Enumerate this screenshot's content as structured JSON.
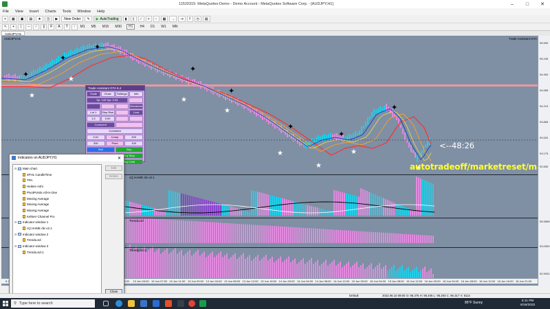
{
  "window": {
    "title": "11520315: MetaQuotes-Demo - Demo Account - MetaQuotes Software Corp. - [AUDJPY,H1]"
  },
  "menu": [
    "File",
    "View",
    "Insert",
    "Charts",
    "Tools",
    "Window",
    "Help"
  ],
  "toolbar": {
    "new_order": "New Order",
    "autotrading": "AutoTrading",
    "timeframes": [
      "M1",
      "M5",
      "M15",
      "M30",
      "H1",
      "H4",
      "D1",
      "W1",
      "MN"
    ]
  },
  "chart": {
    "tab": "AUDJPY,H1",
    "symbol_label": "AUDJPY,H1",
    "ea_label": "Trade Assistant GTA",
    "countdown": "<--48:26",
    "watermark": "autotradeoff/marketreset/manat",
    "price_ticks": [
      "95.590",
      "95.245",
      "94.900",
      "94.555",
      "94.210",
      "93.865",
      "93.520",
      "93.175",
      "92.830"
    ],
    "pane_scales": [
      "95.9898",
      "93.0000",
      "92.9931"
    ],
    "time_ticks": [
      "8 Jun 2022",
      "9 Jun 02:00",
      "9 Jun 06:00",
      "9 Jun 10:00",
      "9 Jun 14:00",
      "9 Jun 18:00",
      "9 Jun 22:00",
      "10 Jun 03:00",
      "10 Jun 07:00",
      "10 Jun 11:00",
      "13 Jun 00:00",
      "13 Jun 04:00",
      "13 Jun 08:00",
      "13 Jun 12:00",
      "13 Jun 16:00",
      "14 Jun 00:00",
      "14 Jun 04:00",
      "14 Jun 08:00",
      "14 Jun 12:00",
      "15 Jun 00:00",
      "15 Jun 04:00",
      "15 Jun 08:00",
      "15 Jun 12:00",
      "16 Jun 00:00",
      "16 Jun 04:00",
      "16 Jun 08:00",
      "16 Jun 12:00",
      "16 Jun 16:00",
      "16 Jun 21:00"
    ],
    "sub_pane_labels": [
      "cQ HAME div v2.1",
      "TrendLord",
      "TrendLord-1"
    ]
  },
  "trade_panel": {
    "title": "Trade Assistant GTA 9.4",
    "tabs": [
      "Trade",
      "Close",
      "Settings",
      "Info"
    ],
    "sp_row": "Sp: 126  Spr: 0.06",
    "rows": [
      [
        "",
        "",
        "",
        "Breakeven"
      ],
      [
        "Lot 1",
        "Stop Risk",
        "",
        "Loss"
      ],
      [
        "1.0",
        "0.00",
        "",
        ""
      ]
    ],
    "comment_label": "Comment",
    "comment_field": "Comment",
    "lot_row": [
      "0.01",
      "Comp",
      "200"
    ],
    "sl_row": [
      "300",
      "Price",
      "100"
    ],
    "buy_sell": [
      "Sell",
      "Buy"
    ],
    "stop_row": [
      "Sell Stop",
      "Buy Stop"
    ],
    "limit_row": [
      "Sell Limit",
      "Buy Limit"
    ]
  },
  "indicators_dialog": {
    "title": "Indicators on AUDJPY,H1",
    "tree": [
      {
        "label": "Main chart",
        "level": 0,
        "kind": "window"
      },
      {
        "label": "4PHL CandleTime",
        "level": 1,
        "kind": "indicator"
      },
      {
        "label": "TPA",
        "level": 1,
        "kind": "indicator"
      },
      {
        "label": "Heiken Ashi",
        "level": 1,
        "kind": "indicator"
      },
      {
        "label": "PivotPoints.All-In-One",
        "level": 1,
        "kind": "indicator"
      },
      {
        "label": "Moving Average",
        "level": 1,
        "kind": "indicator"
      },
      {
        "label": "Moving Average",
        "level": 1,
        "kind": "indicator"
      },
      {
        "label": "Moving Average",
        "level": 1,
        "kind": "indicator"
      },
      {
        "label": "Keltner Channel Pro",
        "level": 1,
        "kind": "indicator"
      },
      {
        "label": "Indicator window 1",
        "level": 0,
        "kind": "window"
      },
      {
        "label": "cQ HAME div v2.1",
        "level": 1,
        "kind": "indicator"
      },
      {
        "label": "Indicator window 2",
        "level": 0,
        "kind": "window"
      },
      {
        "label": "TrendLord",
        "level": 1,
        "kind": "indicator"
      },
      {
        "label": "Indicator window 3",
        "level": 0,
        "kind": "window"
      },
      {
        "label": "TrendLord-1",
        "level": 1,
        "kind": "indicator"
      }
    ],
    "edit_button": "Edit",
    "delete_button": "Delete",
    "close_button": "Close"
  },
  "status_bar": {
    "profile": "Default",
    "readout": "2022.06.10 09:00  O: 95.375  H: 95.405  L: 95.293  C: 95.317  V: 8114"
  },
  "taskbar": {
    "search_placeholder": "Type here to search",
    "weather": "86°F  Sunny",
    "time": "5:11 PM",
    "date": "6/16/2022"
  },
  "colors": {
    "chart_bg": "#7f8fa4",
    "bull_bar": "#1ecfea",
    "bear_bar": "#e48ae0",
    "panel_accent": "#5c3f88",
    "watermark": "#ffff30"
  }
}
